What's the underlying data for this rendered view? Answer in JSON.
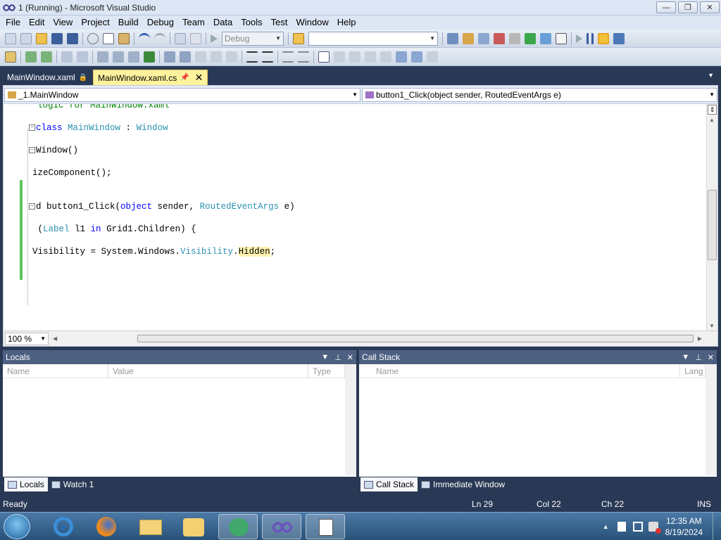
{
  "window": {
    "title": "1 (Running) - Microsoft Visual Studio",
    "minimize": "—",
    "maximize": "❐",
    "close": "✕"
  },
  "menu": [
    "File",
    "Edit",
    "View",
    "Project",
    "Build",
    "Debug",
    "Team",
    "Data",
    "Tools",
    "Test",
    "Window",
    "Help"
  ],
  "toolbar": {
    "config_value": "Debug",
    "search_value": ""
  },
  "tabs": [
    {
      "label": "MainWindow.xaml",
      "pin": "🔒",
      "active": false
    },
    {
      "label": "MainWindow.xaml.cs",
      "pin": "📌",
      "close": "✕",
      "active": true
    }
  ],
  "nav": {
    "class_combo": "_1.MainWindow",
    "member_combo": "button1_Click(object sender, RoutedEventArgs e)"
  },
  "code": {
    "line1": "logic for MainWindow.xaml",
    "line2_kw": "class",
    "line2_name": "MainWindow",
    "line2_sep": " : ",
    "line2_base": "Window",
    "line3": "Window()",
    "line4": "izeComponent();",
    "line5_pre": "d button1_Click(",
    "line5_kw": "object",
    "line5_mid": " sender, ",
    "line5_ty": "RoutedEventArgs",
    "line5_post": " e)",
    "line6_pre": " (",
    "line6_ty": "Label",
    "line6_mid": " l1 ",
    "line6_kw": "in",
    "line6_post": " Grid1.Children) {",
    "line7_pre": "Visibility = System.Windows.",
    "line7_ty": "Visibility",
    "line7_dot": ".",
    "line7_hl": "Hidden",
    "line7_post": ";"
  },
  "zoom": "100 %",
  "locals_panel": {
    "title": "Locals",
    "col_name": "Name",
    "col_value": "Value",
    "col_type": "Type",
    "tab1": "Locals",
    "tab2": "Watch 1"
  },
  "callstack_panel": {
    "title": "Call Stack",
    "col_name": "Name",
    "col_lang": "Lang",
    "tab1": "Call Stack",
    "tab2": "Immediate Window"
  },
  "status": {
    "ready": "Ready",
    "ln": "Ln 29",
    "col": "Col 22",
    "ch": "Ch 22",
    "ins": "INS"
  },
  "taskbar": {
    "time": "12:35 AM",
    "date": "8/19/2024"
  },
  "colors": {
    "accent_tab": "#fff29d",
    "panel_header": "#4d6082",
    "chrome": "#293955"
  }
}
